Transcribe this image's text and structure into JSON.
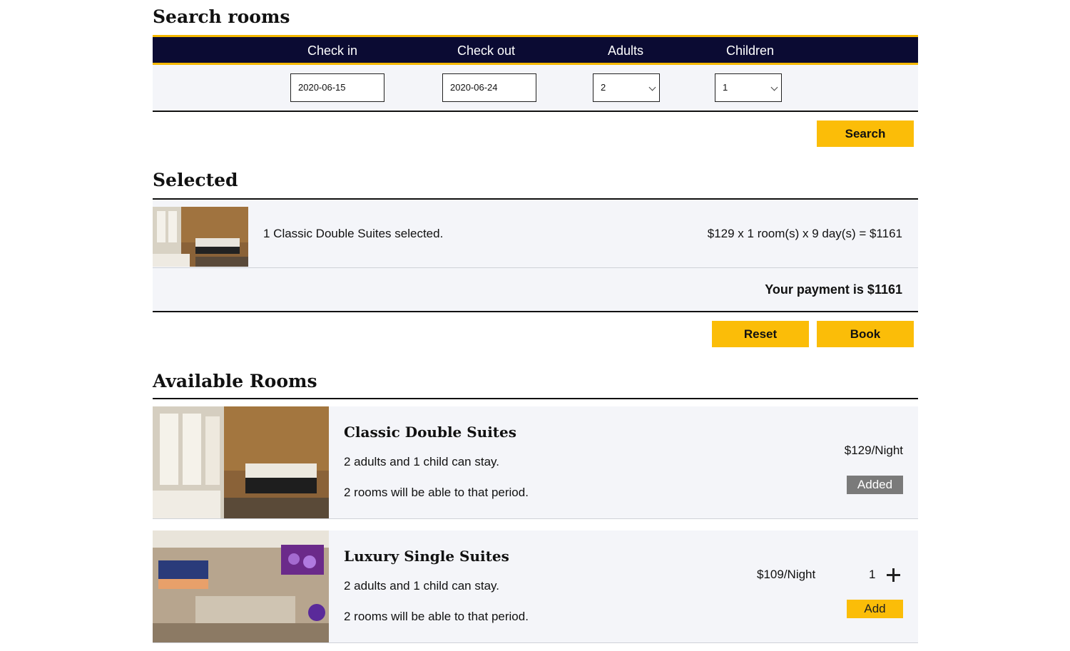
{
  "search": {
    "title": "Search rooms",
    "headers": {
      "checkin": "Check in",
      "checkout": "Check out",
      "adults": "Adults",
      "children": "Children"
    },
    "checkin_value": "2020-06-15",
    "checkout_value": "2020-06-24",
    "adults_value": "2",
    "children_value": "1",
    "search_label": "Search"
  },
  "selected": {
    "title": "Selected",
    "item_text": "1 Classic Double Suites selected.",
    "calc_text": "$129 x 1 room(s) x 9 day(s) = $1161",
    "payment_text": "Your payment is $1161",
    "reset_label": "Reset",
    "book_label": "Book"
  },
  "available": {
    "title": "Available Rooms",
    "rooms": [
      {
        "name": "Classic Double Suites",
        "capacity": "2 adults and 1 child can stay.",
        "availability": "2 rooms will be able to that period.",
        "price": "$129/Night",
        "button": "Added"
      },
      {
        "name": "Luxury Single Suites",
        "capacity": "2 adults and 1 child can stay.",
        "availability": "2 rooms will be able to that period.",
        "price": "$109/Night",
        "quantity": "1",
        "button": "Add"
      }
    ]
  },
  "colors": {
    "accent": "#fbbd08",
    "header_bg": "#0b0b33",
    "panel_bg": "#f4f5f9",
    "added_bg": "#7a7a7a"
  },
  "icons": {
    "dropdown": "chevron-down-icon",
    "increment": "plus-icon"
  }
}
